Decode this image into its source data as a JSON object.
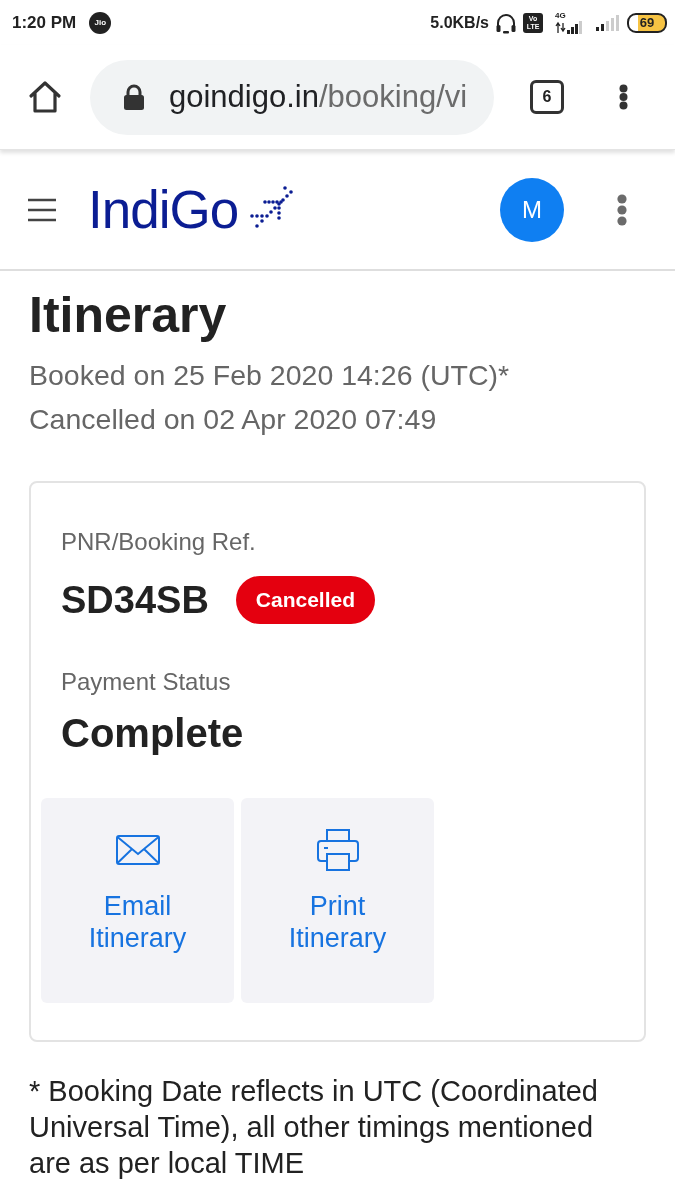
{
  "status_bar": {
    "time": "1:20 PM",
    "carrier_logo": "Jio",
    "network_speed": "5.0KB/s",
    "volte": "Vo LTE",
    "network_type": "4G",
    "battery": "69"
  },
  "browser": {
    "url_host": "goindigo.in",
    "url_path": "/booking/vi",
    "tab_count": "6"
  },
  "site_header": {
    "logo": "IndiGo",
    "avatar_initial": "M"
  },
  "page": {
    "title": "Itinerary",
    "booked_on": "Booked on 25 Feb 2020 14:26 (UTC)*",
    "cancelled_on": "Cancelled on 02 Apr 2020 07:49"
  },
  "booking_card": {
    "pnr_label": "PNR/Booking Ref.",
    "pnr": "SD34SB",
    "status_badge": "Cancelled",
    "payment_label": "Payment Status",
    "payment_status": "Complete",
    "actions": [
      {
        "kind": "email",
        "label": "Email Itinerary"
      },
      {
        "kind": "print",
        "label": "Print Itinerary"
      }
    ]
  },
  "footnote": "* Booking Date reflects in UTC (Coordinated Universal Time), all other timings mentioned are as per local TIME"
}
